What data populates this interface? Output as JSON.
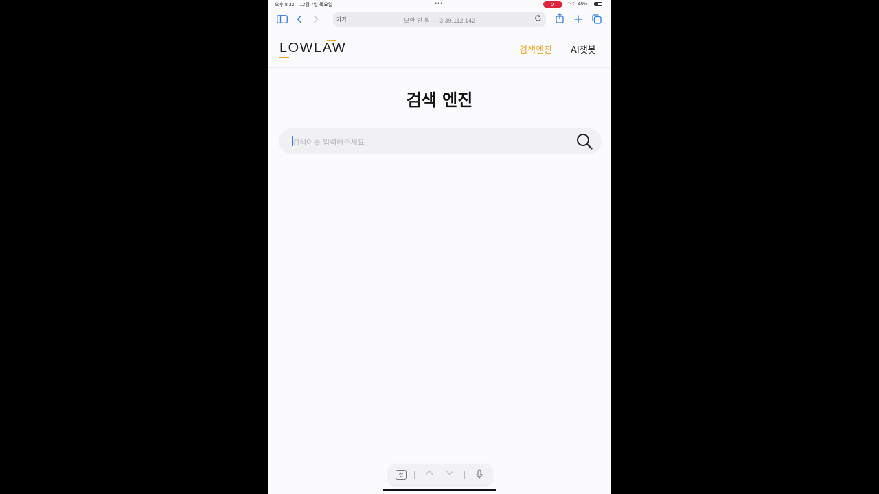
{
  "status_bar": {
    "time": "오후 8:32",
    "date": "12월 7일 목요일",
    "battery": "48%"
  },
  "browser": {
    "reader_label": "가가",
    "address": "보안 안 됨 — 3.39.112.142"
  },
  "header": {
    "logo": "LOWLAW",
    "nav": [
      {
        "label": "검색엔진",
        "active": true,
        "color": "#f0a21c"
      },
      {
        "label": "AI챗봇",
        "active": false
      }
    ]
  },
  "main": {
    "title": "검색 엔진",
    "search": {
      "placeholder": "검색어를 입력해주세요",
      "value": ""
    }
  },
  "keyboard_bar": {
    "ime_label": "한"
  },
  "colors": {
    "accent": "#f0a21c",
    "ios_blue": "#2f7cf6"
  }
}
